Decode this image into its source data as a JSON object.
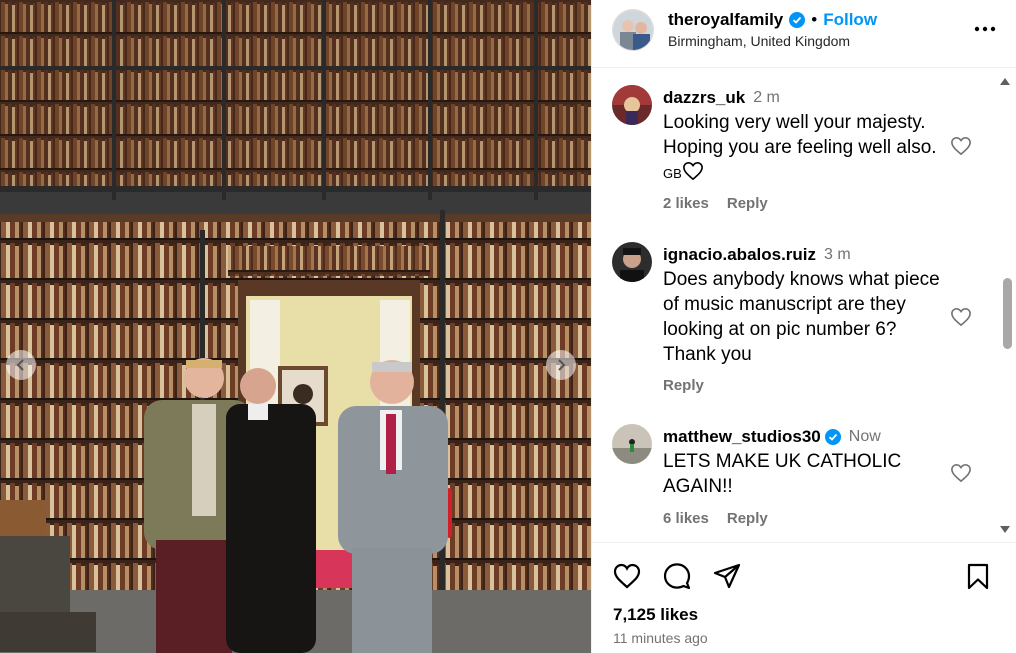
{
  "post": {
    "username": "theroyalfamily",
    "verified": true,
    "separator": "•",
    "follow_label": "Follow",
    "location": "Birmingham, United Kingdom"
  },
  "comments": [
    {
      "username": "dazzrs_uk",
      "verified": false,
      "time": "2 m",
      "text": "Looking very well your majesty. Hoping you are feeling well also.",
      "flag": "GB",
      "likes": "2 likes",
      "reply_label": "Reply"
    },
    {
      "username": "ignacio.abalos.ruiz",
      "verified": false,
      "time": "3 m",
      "text": "Does anybody knows what piece of music manuscript are they looking at on pic number 6? Thank you",
      "likes": "",
      "reply_label": "Reply"
    },
    {
      "username": "matthew_studios30",
      "verified": true,
      "time": "Now",
      "text": "LETS MAKE UK CATHOLIC AGAIN!!",
      "likes": "6 likes",
      "reply_label": "Reply"
    }
  ],
  "footer": {
    "likes": "7,125 likes",
    "time_ago": "11 minutes ago"
  },
  "colors": {
    "accent": "#0095f6",
    "muted": "#737373"
  },
  "icons": [
    "chevron-left-icon",
    "chevron-right-icon",
    "verified-badge-icon",
    "more-options-icon",
    "heart-icon",
    "comment-icon",
    "share-icon",
    "bookmark-icon"
  ]
}
